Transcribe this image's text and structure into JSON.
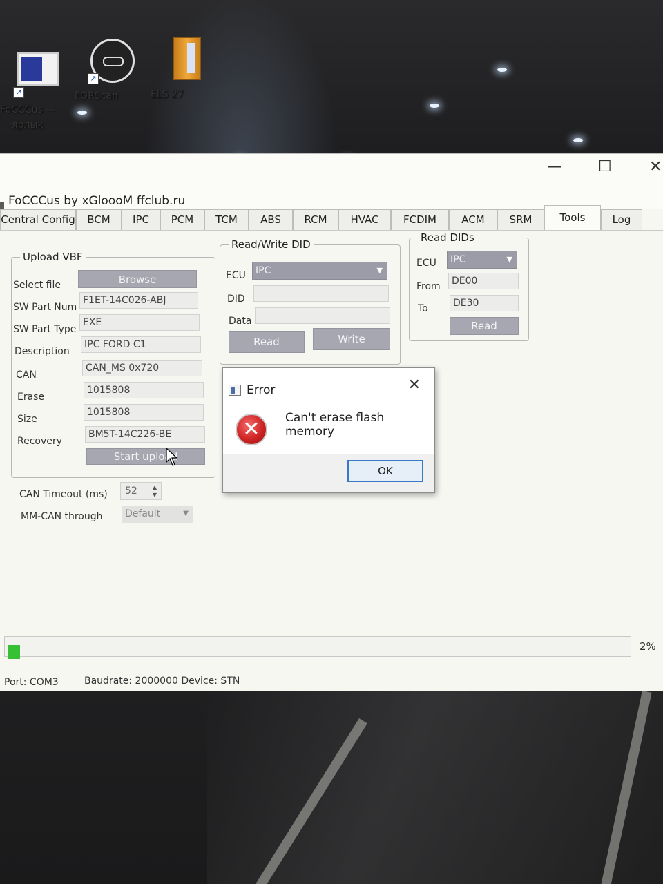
{
  "desktop": {
    "icons": [
      {
        "label": "FoCCCus —\nярлык"
      },
      {
        "label": "FORScan"
      },
      {
        "label": "ELS 27"
      }
    ]
  },
  "window": {
    "title": "FoCCCus by xGloooM ffclub.ru",
    "controls": {
      "minimize": "—",
      "maximize": "☐",
      "close": "✕"
    }
  },
  "tabs": [
    "Central Config",
    "BCM",
    "IPC",
    "PCM",
    "TCM",
    "ABS",
    "RCM",
    "HVAC",
    "FCDIM",
    "ACM",
    "SRM",
    "Tools",
    "Log"
  ],
  "active_tab": "Tools",
  "tab_nav": {
    "left": "◀",
    "overflow": "A"
  },
  "upload_vbf": {
    "title": "Upload VBF",
    "select_file_label": "Select file",
    "browse_label": "Browse",
    "sw_part_num_label": "SW Part Num",
    "sw_part_num": "F1ET-14C026-ABJ",
    "sw_part_type_label": "SW Part Type",
    "sw_part_type": "EXE",
    "description_label": "Description",
    "description": "IPC FORD C1",
    "can_label": "CAN",
    "can": "CAN_MS 0x720",
    "erase_label": "Erase",
    "erase": "1015808",
    "size_label": "Size",
    "size": "1015808",
    "recovery_label": "Recovery",
    "recovery": "BM5T-14C226-BE",
    "start_upload_label": "Start upload"
  },
  "can_timeout": {
    "label": "CAN Timeout (ms)",
    "value": "52"
  },
  "mm_can": {
    "label": "MM-CAN through",
    "value": "Default"
  },
  "rw_did": {
    "title": "Read/Write DID",
    "ecu_label": "ECU",
    "ecu": "IPC",
    "did_label": "DID",
    "did": "",
    "data_label": "Data",
    "data": "",
    "read_label": "Read",
    "write_label": "Write"
  },
  "read_dids": {
    "title": "Read DIDs",
    "ecu_label": "ECU",
    "ecu": "IPC",
    "from_label": "From",
    "from": "DE00",
    "to_label": "To",
    "to": "DE30",
    "read_label": "Read"
  },
  "progress": {
    "percent": 2,
    "label": "2%"
  },
  "status": {
    "port": "Port: COM3",
    "info": "Baudrate: 2000000  Device: STN"
  },
  "dialog": {
    "title": "Error",
    "message": "Can't erase flash memory",
    "ok_label": "OK",
    "close": "✕",
    "error_glyph": "✕"
  },
  "colors": {
    "progress_fill": "#35c035",
    "error_red": "#d02424",
    "button": "#a7a7b1"
  }
}
